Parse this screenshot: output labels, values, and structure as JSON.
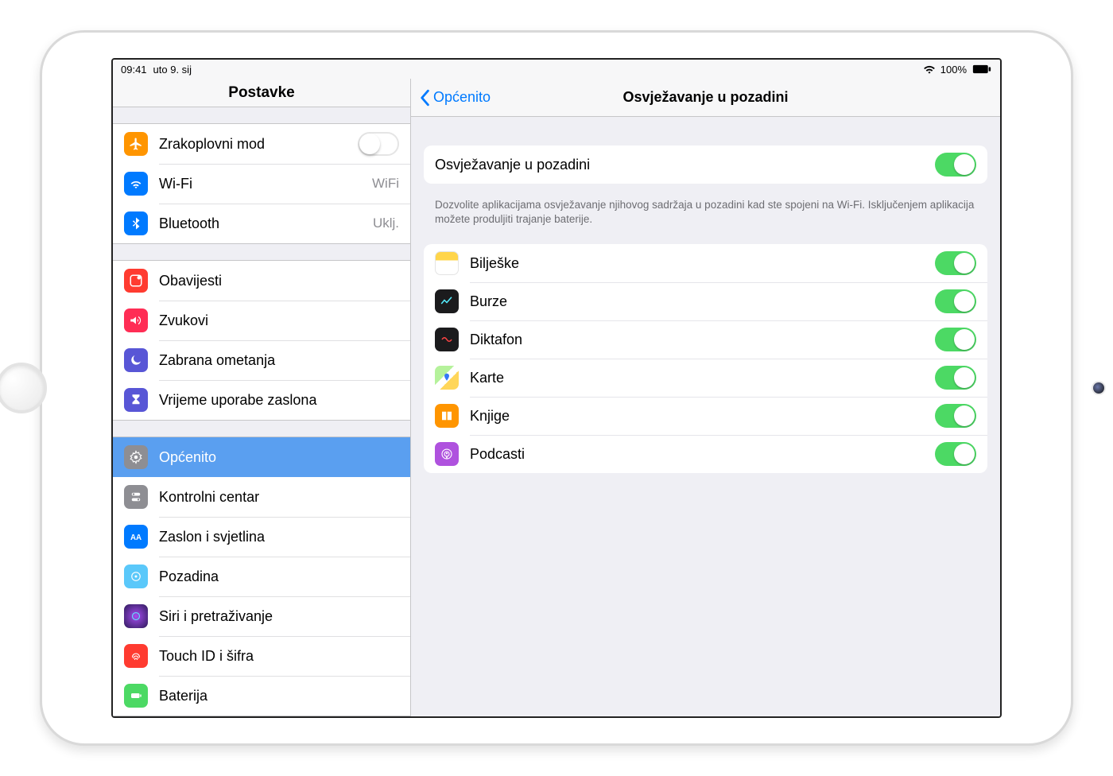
{
  "status_bar": {
    "time": "09:41",
    "date": "uto 9. sij",
    "battery_pct": "100%"
  },
  "sidebar": {
    "title": "Postavke",
    "group1": {
      "airplane": "Zrakoplovni mod",
      "wifi": "Wi-Fi",
      "wifi_value": "WiFi",
      "bluetooth": "Bluetooth",
      "bluetooth_value": "Uklj."
    },
    "group2": {
      "notifications": "Obavijesti",
      "sounds": "Zvukovi",
      "dnd": "Zabrana ometanja",
      "screentime": "Vrijeme uporabe zaslona"
    },
    "group3": {
      "general": "Općenito",
      "control_center": "Kontrolni centar",
      "display": "Zaslon i svjetlina",
      "wallpaper": "Pozadina",
      "siri": "Siri i pretraživanje",
      "touchid": "Touch ID i šifra",
      "battery": "Baterija"
    }
  },
  "detail": {
    "back_label": "Općenito",
    "title": "Osvježavanje u pozadini",
    "master_toggle_label": "Osvježavanje u pozadini",
    "footer": "Dozvolite aplikacijama osvježavanje njihovog sadržaja u pozadini kad ste spojeni na Wi-Fi. Isključenjem aplikacija možete produljiti trajanje baterije.",
    "apps": {
      "notes": "Bilješke",
      "stocks": "Burze",
      "voice_memos": "Diktafon",
      "maps": "Karte",
      "books": "Knjige",
      "podcasts": "Podcasti"
    }
  }
}
